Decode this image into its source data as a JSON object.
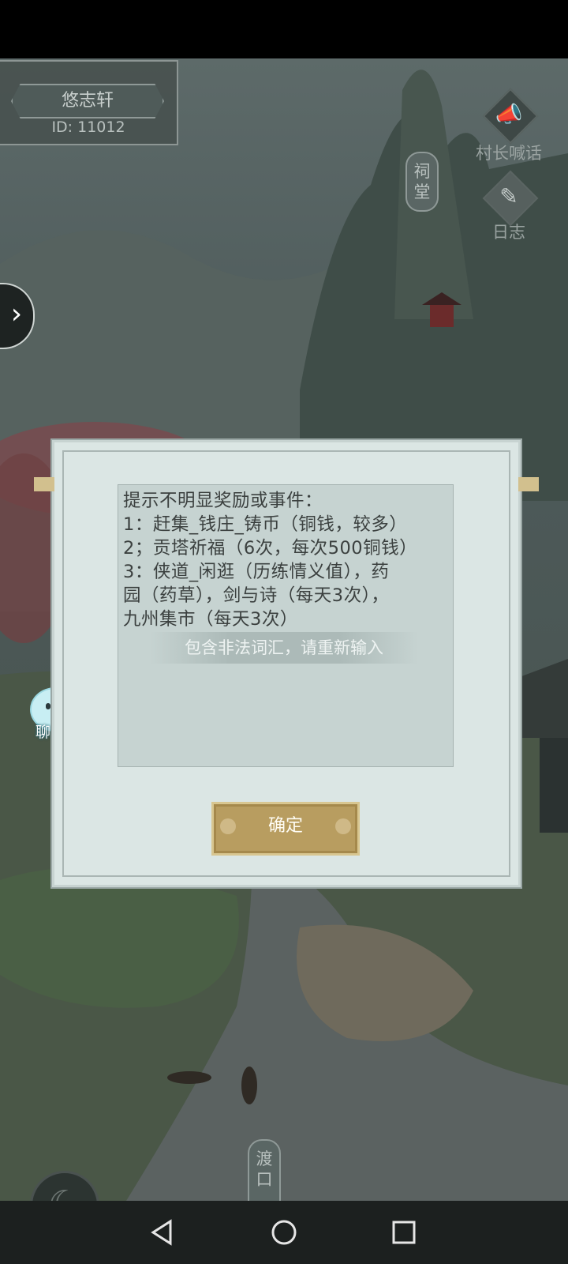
{
  "player": {
    "name": "悠志轩",
    "id": "ID: 11012"
  },
  "right_buttons": {
    "announce": "村长喊话",
    "log": "日志"
  },
  "plaques": {
    "ancestral_hall": "祠堂",
    "ferry": "渡口"
  },
  "chat": {
    "label": "聊天"
  },
  "dialog": {
    "lines": [
      "提示不明显奖励或事件：",
      "1：赶集_钱庄_铸币（铜钱，较多）",
      "2；贡塔祈福（6次，每次500铜钱）",
      "3：侠道_闲逛（历练情义值），药",
      "园（药草），剑与诗（每天3次），",
      "九州集市（每天3次）"
    ],
    "toast": "包含非法词汇，请重新输入",
    "confirm_label": "确定"
  },
  "icons": {
    "expand": "chevron-right-icon",
    "announce": "megaphone-icon",
    "log": "scroll-icon",
    "back": "crescent-back-icon",
    "nav_back": "triangle-back-icon",
    "nav_home": "circle-home-icon",
    "nav_recents": "square-recents-icon"
  },
  "colors": {
    "dialog_bg": "#dbe6e4",
    "button_gold": "#b89d60",
    "scene_overlay": "#4d5a5a"
  }
}
